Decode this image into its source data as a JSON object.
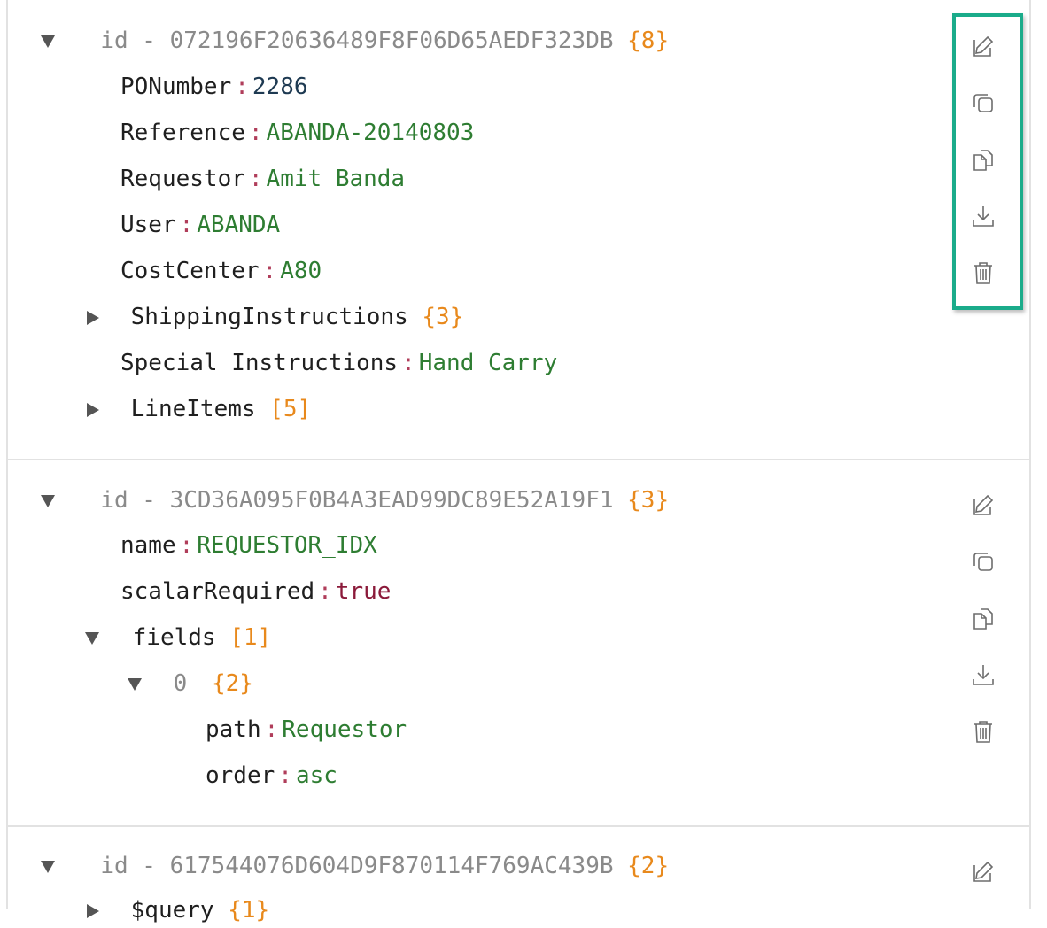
{
  "documents": [
    {
      "id_label": "id",
      "dash": "-",
      "id": "072196F20636489F8F06D65AEDF323DB",
      "count": "{8}",
      "fields": [
        {
          "key": "PONumber",
          "value": "2286",
          "type": "num"
        },
        {
          "key": "Reference",
          "value": "ABANDA-20140803",
          "type": "str"
        },
        {
          "key": "Requestor",
          "value": "Amit Banda",
          "type": "str"
        },
        {
          "key": "User",
          "value": "ABANDA",
          "type": "str"
        },
        {
          "key": "CostCenter",
          "value": "A80",
          "type": "str"
        },
        {
          "key": "ShippingInstructions",
          "count": "{3}",
          "collapsed": true
        },
        {
          "key": "Special Instructions",
          "value": "Hand Carry",
          "type": "str"
        },
        {
          "key": "LineItems",
          "count": "[5]",
          "collapsed": true
        }
      ]
    },
    {
      "id_label": "id",
      "dash": "-",
      "id": "3CD36A095F0B4A3EAD99DC89E52A19F1",
      "count": "{3}",
      "fields": [
        {
          "key": "name",
          "value": "REQUESTOR_IDX",
          "type": "str"
        },
        {
          "key": "scalarRequired",
          "value": "true",
          "type": "bool"
        },
        {
          "key": "fields",
          "count": "[1]",
          "collapsed": false
        },
        {
          "key": "0",
          "count": "{2}",
          "collapsed": false
        },
        {
          "key": "path",
          "value": "Requestor",
          "type": "str"
        },
        {
          "key": "order",
          "value": "asc",
          "type": "str"
        }
      ]
    },
    {
      "id_label": "id",
      "dash": "-",
      "id": "617544076D604D9F870114F769AC439B",
      "count": "{2}",
      "fields": [
        {
          "key": "$query",
          "count": "{1}",
          "collapsed": true
        }
      ]
    }
  ],
  "actions": [
    "edit-icon",
    "clone-icon",
    "copy-icon",
    "download-icon",
    "delete-icon"
  ],
  "colors": {
    "accent_highlight": "#1aab8a",
    "count": "#e8891c",
    "string": "#2e7d32",
    "bool": "#8b1a3a",
    "number": "#1e3a52"
  }
}
